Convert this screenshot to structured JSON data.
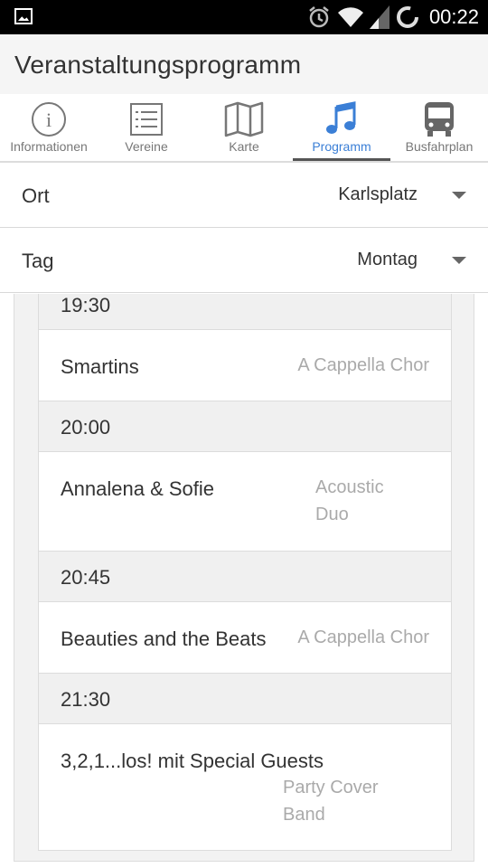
{
  "status_bar": {
    "time": "00:22",
    "icons": [
      "gallery-icon",
      "alarm-icon",
      "wifi-icon",
      "signal-icon",
      "sync-icon"
    ]
  },
  "app": {
    "title": "Veranstaltungsprogramm"
  },
  "tabs": [
    {
      "label": "Informationen",
      "icon": "info-icon",
      "active": false
    },
    {
      "label": "Vereine",
      "icon": "list-icon",
      "active": false
    },
    {
      "label": "Karte",
      "icon": "map-icon",
      "active": false
    },
    {
      "label": "Programm",
      "icon": "music-note-icon",
      "active": true
    },
    {
      "label": "Busfahrplan",
      "icon": "bus-icon",
      "active": false
    }
  ],
  "colors": {
    "accent": "#3b7fd6",
    "tab_icon": "#777777"
  },
  "filters": {
    "ort": {
      "label": "Ort",
      "value": "Karlsplatz"
    },
    "tag": {
      "label": "Tag",
      "value": "Montag"
    }
  },
  "schedule": [
    {
      "time": "19:30",
      "name": "Smartins",
      "category": "A Cappella Chor"
    },
    {
      "time": "20:00",
      "name": "Annalena & Sofie",
      "category": "Acoustic Duo"
    },
    {
      "time": "20:45",
      "name": "Beauties and the Beats",
      "category": "A Cappella Chor"
    },
    {
      "time": "21:30",
      "name": "3,2,1...los! mit Special Guests",
      "category": "Party Cover Band"
    }
  ]
}
